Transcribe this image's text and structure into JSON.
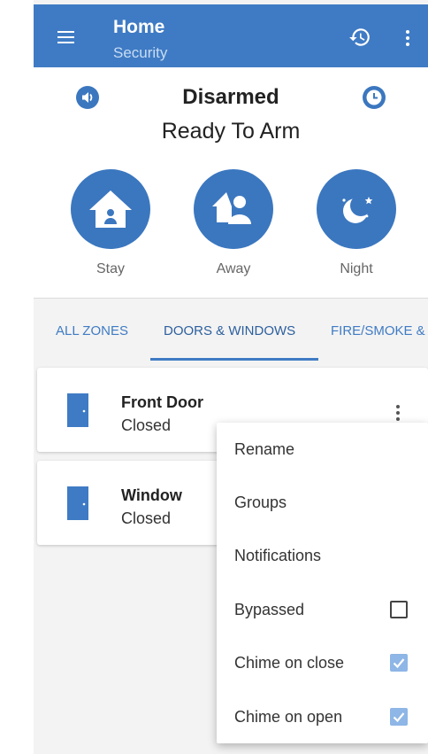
{
  "app_bar": {
    "title": "Home",
    "subtitle": "Security",
    "color": "#3f7bc4"
  },
  "status": {
    "title": "Disarmed",
    "subtitle": "Ready To Arm"
  },
  "arm_buttons": [
    {
      "label": "Stay",
      "icon": "house-icon"
    },
    {
      "label": "Away",
      "icon": "people-icon"
    },
    {
      "label": "Night",
      "icon": "moon-star-icon"
    }
  ],
  "tabs": [
    {
      "label": "ALL ZONES",
      "active": false
    },
    {
      "label": "DOORS & WINDOWS",
      "active": true
    },
    {
      "label": "FIRE/SMOKE &",
      "active": false
    }
  ],
  "zones": [
    {
      "name": "Front Door",
      "status": "Closed",
      "icon": "door-icon"
    },
    {
      "name": "Window",
      "status": "Closed",
      "icon": "door-icon"
    }
  ],
  "context_menu": {
    "items": [
      {
        "label": "Rename"
      },
      {
        "label": "Groups"
      },
      {
        "label": "Notifications"
      },
      {
        "label": "Bypassed",
        "checked": false
      },
      {
        "label": "Chime on close",
        "checked": true
      },
      {
        "label": "Chime on open",
        "checked": true
      }
    ]
  }
}
